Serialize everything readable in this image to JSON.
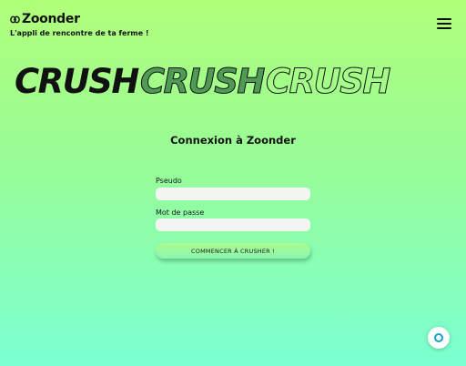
{
  "brand": {
    "name": "Zoonder",
    "tagline": "L'appli de rencontre de ta ferme !",
    "icon": "zoonder-logo-icon"
  },
  "header": {
    "menu_icon": "hamburger-menu-icon"
  },
  "banner": {
    "words": [
      "CRUSH",
      "CRUSH",
      "CRUSH"
    ],
    "colors": {
      "solid": "#111111",
      "green": "#4f9a55",
      "outline": "#111111"
    }
  },
  "login": {
    "title": "Connexion à Zoonder",
    "username_label": "Pseudo",
    "username_value": "",
    "password_label": "Mot de passe",
    "password_value": "",
    "submit_label": "COMMENCER À CRUSHER !"
  },
  "help_widget": {
    "icon": "help-ring-icon",
    "accent": "#1aa2cf"
  },
  "theme": {
    "gradient_top": "#b1ff7a",
    "gradient_bottom": "#7bffd2"
  }
}
